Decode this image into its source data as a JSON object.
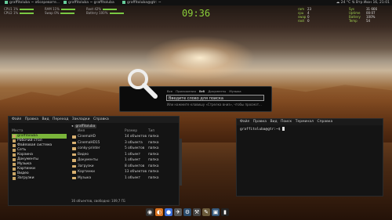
{
  "topbar": {
    "tasks": [
      {
        "label": "graffitoluba ~ обозревате..."
      },
      {
        "label": "graffitoluba ~ graffitoluba"
      },
      {
        "label": "graffitoluba@gtr: ~"
      }
    ],
    "weather": "24 °C",
    "datetime": "Втр Июн 16, 21:01"
  },
  "meters": [
    {
      "label": "CPU1  1%"
    },
    {
      "label": "CPU2  1%"
    },
    {
      "label": "RAM  11%"
    },
    {
      "label": "Swap  0%"
    },
    {
      "label": "Root  42%"
    },
    {
      "label": "Battery 100%"
    }
  ],
  "clock": "09:36",
  "sys_right": [
    {
      "l": "ram",
      "v": "23"
    },
    {
      "l": "cpu",
      "v": "4"
    },
    {
      "l": "swap",
      "v": "0"
    },
    {
      "l": "root",
      "v": "0"
    }
  ],
  "sys_right2": [
    {
      "l": "Sys",
      "v": "31 666"
    },
    {
      "l": "Uptime",
      "v": "00:07"
    },
    {
      "l": "Battery",
      "v": "100%"
    },
    {
      "l": "Temp",
      "v": "54"
    }
  ],
  "search": {
    "categories": [
      "Все",
      "Приложения",
      "Веб",
      "Документы",
      "Музыка"
    ],
    "placeholder": "Введите слово для поиска",
    "hint": "Или нажмите клавишу «Стрелка вниз», чтобы просмот..."
  },
  "filemanager": {
    "menu": [
      "Файл",
      "Правка",
      "Вид",
      "Переход",
      "Закладки",
      "Справка"
    ],
    "places_header": "Места",
    "places": [
      "graffitoluba",
      "Рабочий стол",
      "Файловая система",
      "Сеть",
      "Корзина",
      "Документы",
      "Музыка",
      "Картинки",
      "Видео",
      "Загрузки"
    ],
    "breadcrumb": "graffitoluba",
    "columns": {
      "name": "Имя",
      "size": "Размер",
      "type": "Тип"
    },
    "rows": [
      {
        "name": "CinemaHD",
        "size": "14 объектов",
        "type": "папка"
      },
      {
        "name": "CinemaHD15",
        "size": "3 объекта",
        "type": "папка"
      },
      {
        "name": "conky-printer",
        "size": "5 объектов",
        "type": "папка"
      },
      {
        "name": "Видео",
        "size": "1 объект",
        "type": "папка"
      },
      {
        "name": "Документы",
        "size": "1 объект",
        "type": "папка"
      },
      {
        "name": "Загрузки",
        "size": "8 объектов",
        "type": "папка"
      },
      {
        "name": "Картинки",
        "size": "13 объектов",
        "type": "папка"
      },
      {
        "name": "Музыка",
        "size": "1 объект",
        "type": "папка"
      }
    ],
    "status": "16 объектов, свободно: 109,7 ГБ"
  },
  "terminal": {
    "menu": [
      "Файл",
      "Правка",
      "Вид",
      "Поиск",
      "Терминал",
      "Справка"
    ],
    "prompt": "graffitoluba@gtr:~$ "
  },
  "dock": [
    {
      "name": "ubuntu-icon",
      "glyph": "◉",
      "color": "#333333"
    },
    {
      "name": "firefox-icon",
      "glyph": "◐",
      "color": "#d9731f"
    },
    {
      "name": "chrome-icon",
      "glyph": "●",
      "color": "#3a6fd8"
    },
    {
      "name": "bird-icon",
      "glyph": "✈",
      "color": "#555555"
    },
    {
      "name": "steam-icon",
      "glyph": "⚙",
      "color": "#2a4a6a"
    },
    {
      "name": "settings-icon",
      "glyph": "⚒",
      "color": "#444444"
    },
    {
      "name": "gimp-icon",
      "glyph": "✎",
      "color": "#6a5a3a"
    },
    {
      "name": "monitor-icon",
      "glyph": "▣",
      "color": "#335577"
    },
    {
      "name": "terminal-icon",
      "glyph": "▮",
      "color": "#222222"
    }
  ]
}
